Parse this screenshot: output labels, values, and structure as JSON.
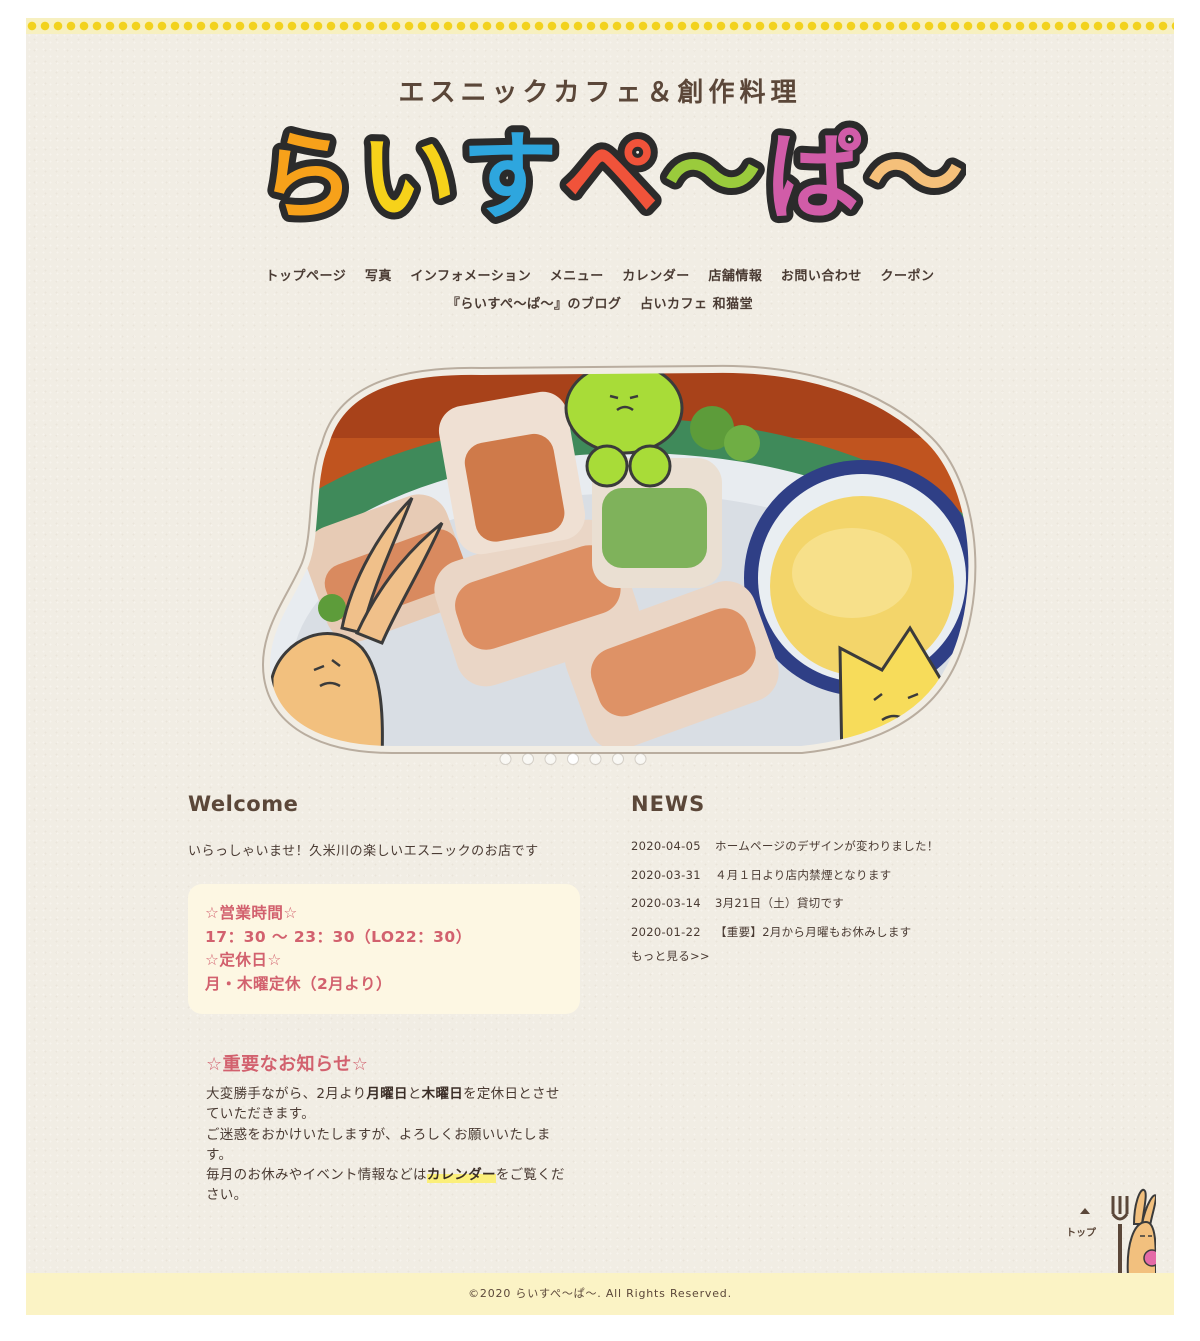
{
  "header": {
    "subtitle": "エスニックカフェ＆創作料理",
    "logo_text": "らいすぺ〜ぱ〜",
    "logo_chars": [
      {
        "ch": "ら",
        "color": "#f7a11a"
      },
      {
        "ch": "い",
        "color": "#f6d21a"
      },
      {
        "ch": "す",
        "color": "#2ea6de"
      },
      {
        "ch": "ペ",
        "color": "#f0533a"
      },
      {
        "ch": "〜",
        "color": "#9acb3c"
      },
      {
        "ch": "ぱ",
        "color": "#d15ca8"
      },
      {
        "ch": "〜",
        "color": "#f5c07a"
      }
    ]
  },
  "nav": {
    "items": [
      "トップページ",
      "写真",
      "インフォメーション",
      "メニュー",
      "カレンダー",
      "店舗情報",
      "お問い合わせ",
      "クーポン"
    ],
    "items_row2": [
      "『らいすぺ〜ぱ〜』のブログ",
      "占いカフェ 和猫堂"
    ]
  },
  "hero": {
    "slide_count": 7,
    "active_slide": 4
  },
  "welcome": {
    "title": "Welcome",
    "text": "いらっしゃいませ！久米川の楽しいエスニックのお店です",
    "hours_lines": [
      "☆営業時間☆",
      "17：30 〜 23：30（LO22：30）",
      "☆定休日☆",
      "月・木曜定休（2月より）"
    ]
  },
  "notice": {
    "title": "☆重要なお知らせ☆",
    "p1_a": "大変勝手ながら、2月より",
    "p1_b": "月曜日",
    "p1_c": "と",
    "p1_d": "木曜日",
    "p1_e": "を定休日とさせていただきます。",
    "p2": "ご迷惑をおかけいたしますが、よろしくお願いいたします。",
    "p3_a": "毎月のお休みやイベント情報などは",
    "p3_b": "カレンダー",
    "p3_c": "をご覧ください。"
  },
  "news": {
    "title": "NEWS",
    "items": [
      {
        "date": "2020-04-05",
        "text": "ホームページのデザインが変わりました！"
      },
      {
        "date": "2020-03-31",
        "text": "４月１日より店内禁煙となります"
      },
      {
        "date": "2020-03-14",
        "text": "3月21日（土）貸切です"
      },
      {
        "date": "2020-01-22",
        "text": "【重要】2月から月曜もお休みします"
      }
    ],
    "more": "もっと見る>>"
  },
  "to_top": {
    "label": "トップ"
  },
  "footer": {
    "copyright": "©2020 らいすぺ〜ぱ〜. All Rights Reserved."
  },
  "colors": {
    "background": "#f1ede4",
    "accent_pink": "#d2616e",
    "text_brown": "#4a3b33",
    "footer_bg": "#fbf3c5"
  }
}
